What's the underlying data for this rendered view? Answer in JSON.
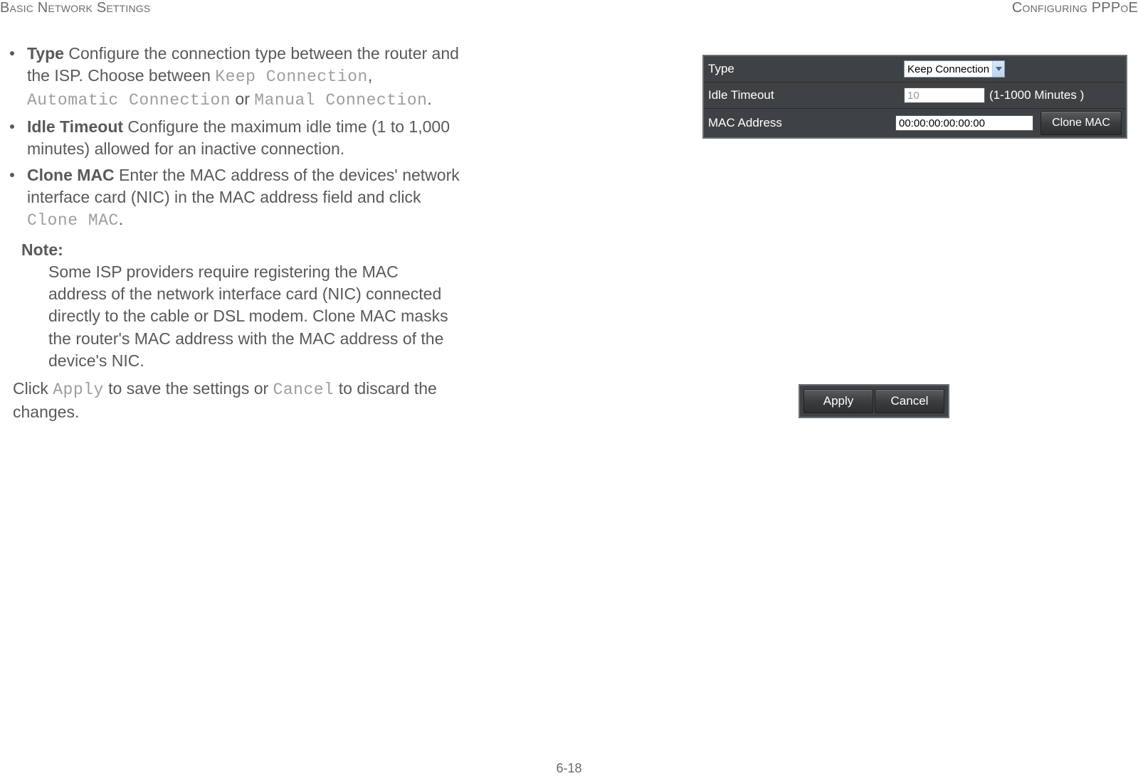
{
  "header": {
    "left": "Basic Network Settings",
    "right": "Configuring PPPoE"
  },
  "bullets": {
    "type": {
      "term": "Type",
      "t1": "  Configure the connection type between the router and the ISP. Choose between ",
      "o1": "Keep Connection",
      "sep1": ", ",
      "o2": "Automatic Connection",
      "or": " or ",
      "o3": "Manual Connection",
      "end": "."
    },
    "idle": {
      "term": "Idle Timeout",
      "text": "  Configure the maximum idle time (1 to 1,000 minutes) allowed for an inactive connection."
    },
    "clone": {
      "term": "Clone MAC",
      "t1": "  Enter the MAC address of the devices' net­work interface card (NIC) in the MAC address field and click ",
      "cmd": "Clone MAC",
      "end": "."
    }
  },
  "note": {
    "label": "Note:",
    "body": "Some ISP providers require registering the MAC address of the network interface card (NIC) connected directly to the cable or DSL modem. Clone MAC masks the router's MAC address with the MAC address of the device's NIC."
  },
  "outro": {
    "p1": "Click ",
    "apply": "Apply",
    "p2": " to save the settings or ",
    "cancel": "Cancel",
    "p3": " to discard the changes."
  },
  "panel": {
    "type_label": "Type",
    "type_value": "Keep Connection",
    "idle_label": "Idle Timeout",
    "idle_value": "10",
    "idle_hint": "(1-1000 Minutes )",
    "mac_label": "MAC Address",
    "mac_value": "00:00:00:00:00:00",
    "clone_btn": "Clone MAC"
  },
  "buttons": {
    "apply": "Apply",
    "cancel": "Cancel"
  },
  "footer": "6-18"
}
